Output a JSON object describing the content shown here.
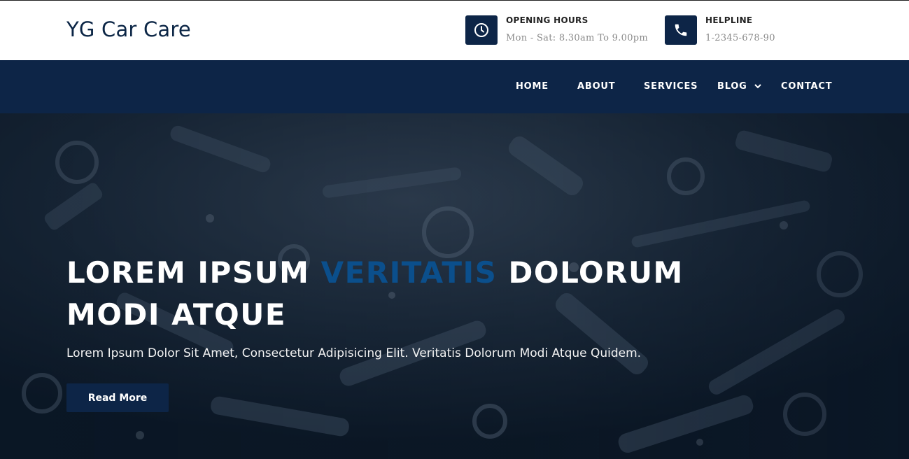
{
  "brand": {
    "name": "YG Car Care"
  },
  "header_info": {
    "hours": {
      "title": "OPENING HOURS",
      "text": "Mon - Sat: 8.30am To 9.00pm",
      "icon": "clock-icon"
    },
    "helpline": {
      "title": "HELPLINE",
      "text": "1-2345-678-90",
      "icon": "phone-icon"
    }
  },
  "nav": {
    "items": [
      {
        "label": "HOME"
      },
      {
        "label": "ABOUT"
      },
      {
        "label": "SERVICES"
      },
      {
        "label": "BLOG"
      },
      {
        "label": "CONTACT"
      }
    ],
    "blog_dropdown_icon": "chevron-down-icon"
  },
  "hero": {
    "title_part1": "LOREM IPSUM ",
    "title_accent": "VERITATIS",
    "title_part2": " DOLORUM MODI ATQUE",
    "subtitle": "Lorem Ipsum Dolor Sit Amet, Consectetur Adipisicing Elit. Veritatis Dolorum Modi Atque Quidem.",
    "button_label": "Read More"
  },
  "colors": {
    "primary": "#0d2547",
    "accent": "#0b4f8c",
    "white": "#ffffff"
  }
}
